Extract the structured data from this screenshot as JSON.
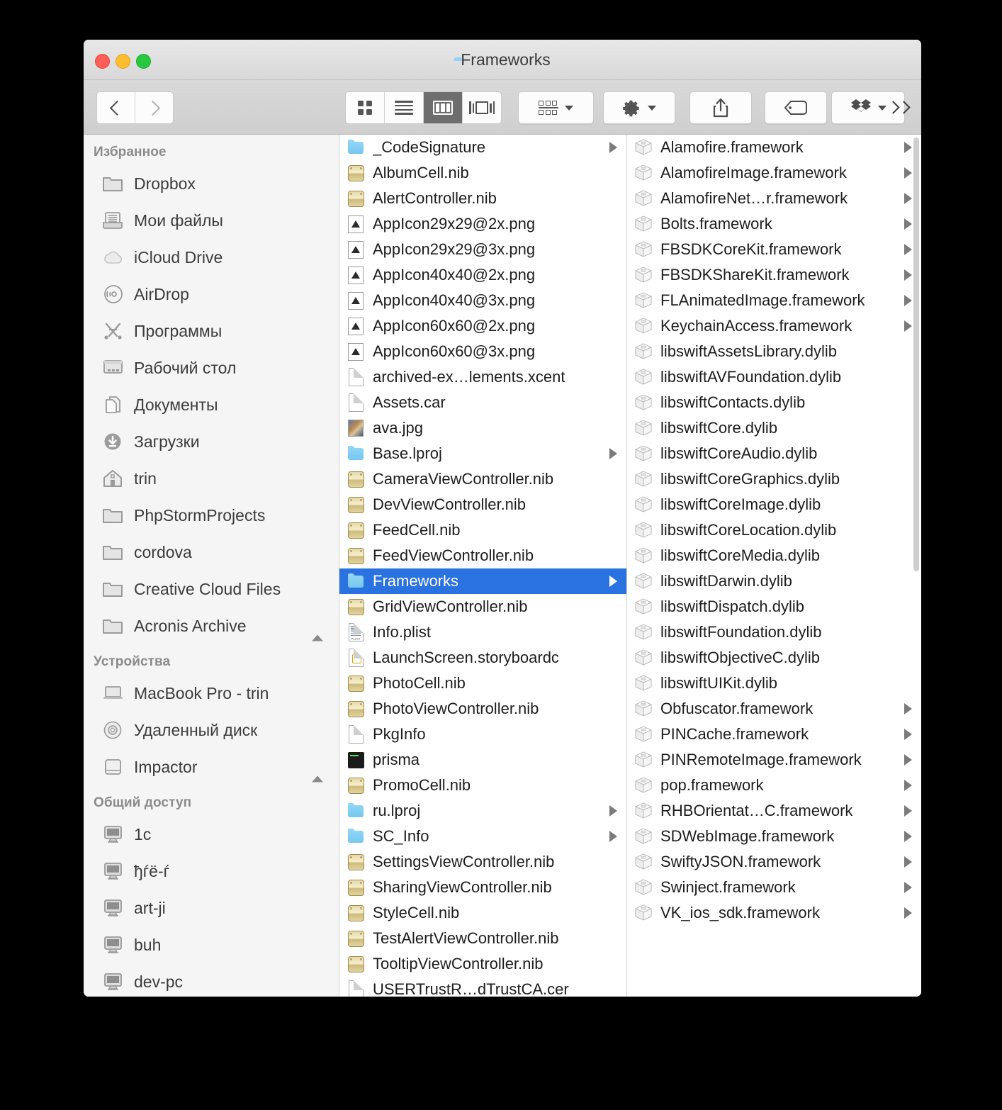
{
  "window": {
    "title": "Frameworks",
    "traffic_lights": [
      "close",
      "minimize",
      "zoom"
    ],
    "accent_selection": "#2a72e0"
  },
  "toolbar": {
    "back_label": "Back",
    "forward_label": "Forward",
    "views": [
      {
        "name": "icon-view",
        "label": "Icon View",
        "active": false
      },
      {
        "name": "list-view",
        "label": "List View",
        "active": false
      },
      {
        "name": "column-view",
        "label": "Column View",
        "active": true
      },
      {
        "name": "cover-flow-view",
        "label": "Cover Flow View",
        "active": false
      }
    ],
    "arrange_label": "Arrange",
    "action_label": "Action",
    "share_label": "Share",
    "tag_label": "Edit Tags",
    "dropbox_label": "Dropbox",
    "overflow_label": "More toolbar items"
  },
  "sidebar": {
    "sections": [
      {
        "header": "Избранное",
        "items": [
          {
            "label": "Dropbox",
            "icon": "folder-icon",
            "eject": false
          },
          {
            "label": "Мои файлы",
            "icon": "all-my-files-icon",
            "eject": false
          },
          {
            "label": "iCloud Drive",
            "icon": "icloud-icon",
            "eject": false
          },
          {
            "label": "AirDrop",
            "icon": "airdrop-icon",
            "eject": false
          },
          {
            "label": "Программы",
            "icon": "applications-icon",
            "eject": false
          },
          {
            "label": "Рабочий стол",
            "icon": "desktop-icon",
            "eject": false
          },
          {
            "label": "Документы",
            "icon": "documents-icon",
            "eject": false
          },
          {
            "label": "Загрузки",
            "icon": "downloads-icon",
            "eject": false
          },
          {
            "label": "trin",
            "icon": "home-icon",
            "eject": false
          },
          {
            "label": "PhpStormProjects",
            "icon": "folder-icon",
            "eject": false
          },
          {
            "label": "cordova",
            "icon": "folder-icon",
            "eject": false
          },
          {
            "label": "Creative Cloud Files",
            "icon": "folder-icon",
            "eject": false
          },
          {
            "label": "Acronis Archive",
            "icon": "folder-icon",
            "eject": true
          }
        ]
      },
      {
        "header": "Устройства",
        "items": [
          {
            "label": "MacBook Pro - trin",
            "icon": "laptop-icon",
            "eject": false
          },
          {
            "label": "Удаленный диск",
            "icon": "disc-icon",
            "eject": false
          },
          {
            "label": "Impactor",
            "icon": "harddisk-icon",
            "eject": true
          }
        ]
      },
      {
        "header": "Общий доступ",
        "items": [
          {
            "label": "1c",
            "icon": "display-icon",
            "eject": false
          },
          {
            "label": "ђѓё-ѓ",
            "icon": "display-icon",
            "eject": false
          },
          {
            "label": "art-ji",
            "icon": "display-icon",
            "eject": false
          },
          {
            "label": "buh",
            "icon": "display-icon",
            "eject": false
          },
          {
            "label": "dev-pc",
            "icon": "display-icon",
            "eject": false
          }
        ]
      }
    ]
  },
  "column_middle": {
    "rows": [
      {
        "name": "_CodeSignature",
        "icon": "folder-blue-icon",
        "disclosure": true,
        "selected": false
      },
      {
        "name": "AlbumCell.nib",
        "icon": "nib-icon",
        "disclosure": false,
        "selected": false
      },
      {
        "name": "AlertController.nib",
        "icon": "nib-icon",
        "disclosure": false,
        "selected": false
      },
      {
        "name": "AppIcon29x29@2x.png",
        "icon": "png-icon",
        "disclosure": false,
        "selected": false
      },
      {
        "name": "AppIcon29x29@3x.png",
        "icon": "png-icon",
        "disclosure": false,
        "selected": false
      },
      {
        "name": "AppIcon40x40@2x.png",
        "icon": "png-icon",
        "disclosure": false,
        "selected": false
      },
      {
        "name": "AppIcon40x40@3x.png",
        "icon": "png-icon",
        "disclosure": false,
        "selected": false
      },
      {
        "name": "AppIcon60x60@2x.png",
        "icon": "png-icon",
        "disclosure": false,
        "selected": false
      },
      {
        "name": "AppIcon60x60@3x.png",
        "icon": "png-icon",
        "disclosure": false,
        "selected": false
      },
      {
        "name": "archived-ex…lements.xcent",
        "icon": "document-icon",
        "disclosure": false,
        "selected": false
      },
      {
        "name": "Assets.car",
        "icon": "document-icon",
        "disclosure": false,
        "selected": false
      },
      {
        "name": "ava.jpg",
        "icon": "image-icon",
        "disclosure": false,
        "selected": false
      },
      {
        "name": "Base.lproj",
        "icon": "folder-blue-icon",
        "disclosure": true,
        "selected": false
      },
      {
        "name": "CameraViewController.nib",
        "icon": "nib-icon",
        "disclosure": false,
        "selected": false
      },
      {
        "name": "DevViewController.nib",
        "icon": "nib-icon",
        "disclosure": false,
        "selected": false
      },
      {
        "name": "FeedCell.nib",
        "icon": "nib-icon",
        "disclosure": false,
        "selected": false
      },
      {
        "name": "FeedViewController.nib",
        "icon": "nib-icon",
        "disclosure": false,
        "selected": false
      },
      {
        "name": "Frameworks",
        "icon": "folder-blue-icon",
        "disclosure": true,
        "selected": true
      },
      {
        "name": "GridViewController.nib",
        "icon": "nib-icon",
        "disclosure": false,
        "selected": false
      },
      {
        "name": "Info.plist",
        "icon": "plist-icon",
        "disclosure": false,
        "selected": false
      },
      {
        "name": "LaunchScreen.storyboardc",
        "icon": "storyboard-icon",
        "disclosure": false,
        "selected": false
      },
      {
        "name": "PhotoCell.nib",
        "icon": "nib-icon",
        "disclosure": false,
        "selected": false
      },
      {
        "name": "PhotoViewController.nib",
        "icon": "nib-icon",
        "disclosure": false,
        "selected": false
      },
      {
        "name": "PkgInfo",
        "icon": "document-icon",
        "disclosure": false,
        "selected": false
      },
      {
        "name": "prisma",
        "icon": "unix-executable-icon",
        "disclosure": false,
        "selected": false
      },
      {
        "name": "PromoCell.nib",
        "icon": "nib-icon",
        "disclosure": false,
        "selected": false
      },
      {
        "name": "ru.lproj",
        "icon": "folder-blue-icon",
        "disclosure": true,
        "selected": false
      },
      {
        "name": "SC_Info",
        "icon": "folder-blue-icon",
        "disclosure": true,
        "selected": false
      },
      {
        "name": "SettingsViewController.nib",
        "icon": "nib-icon",
        "disclosure": false,
        "selected": false
      },
      {
        "name": "SharingViewController.nib",
        "icon": "nib-icon",
        "disclosure": false,
        "selected": false
      },
      {
        "name": "StyleCell.nib",
        "icon": "nib-icon",
        "disclosure": false,
        "selected": false
      },
      {
        "name": "TestAlertViewController.nib",
        "icon": "nib-icon",
        "disclosure": false,
        "selected": false
      },
      {
        "name": "TooltipViewController.nib",
        "icon": "nib-icon",
        "disclosure": false,
        "selected": false
      },
      {
        "name": "USERTrustR…dTrustCA.cer",
        "icon": "document-icon",
        "disclosure": false,
        "selected": false
      }
    ]
  },
  "column_right": {
    "rows": [
      {
        "name": "Alamofire.framework",
        "icon": "framework-icon",
        "disclosure": true
      },
      {
        "name": "AlamofireImage.framework",
        "icon": "framework-icon",
        "disclosure": true
      },
      {
        "name": "AlamofireNet…r.framework",
        "icon": "framework-icon",
        "disclosure": true
      },
      {
        "name": "Bolts.framework",
        "icon": "framework-icon",
        "disclosure": true
      },
      {
        "name": "FBSDKCoreKit.framework",
        "icon": "framework-icon",
        "disclosure": true
      },
      {
        "name": "FBSDKShareKit.framework",
        "icon": "framework-icon",
        "disclosure": true
      },
      {
        "name": "FLAnimatedImage.framework",
        "icon": "framework-icon",
        "disclosure": true
      },
      {
        "name": "KeychainAccess.framework",
        "icon": "framework-icon",
        "disclosure": true
      },
      {
        "name": "libswiftAssetsLibrary.dylib",
        "icon": "framework-icon",
        "disclosure": false
      },
      {
        "name": "libswiftAVFoundation.dylib",
        "icon": "framework-icon",
        "disclosure": false
      },
      {
        "name": "libswiftContacts.dylib",
        "icon": "framework-icon",
        "disclosure": false
      },
      {
        "name": "libswiftCore.dylib",
        "icon": "framework-icon",
        "disclosure": false
      },
      {
        "name": "libswiftCoreAudio.dylib",
        "icon": "framework-icon",
        "disclosure": false
      },
      {
        "name": "libswiftCoreGraphics.dylib",
        "icon": "framework-icon",
        "disclosure": false
      },
      {
        "name": "libswiftCoreImage.dylib",
        "icon": "framework-icon",
        "disclosure": false
      },
      {
        "name": "libswiftCoreLocation.dylib",
        "icon": "framework-icon",
        "disclosure": false
      },
      {
        "name": "libswiftCoreMedia.dylib",
        "icon": "framework-icon",
        "disclosure": false
      },
      {
        "name": "libswiftDarwin.dylib",
        "icon": "framework-icon",
        "disclosure": false
      },
      {
        "name": "libswiftDispatch.dylib",
        "icon": "framework-icon",
        "disclosure": false
      },
      {
        "name": "libswiftFoundation.dylib",
        "icon": "framework-icon",
        "disclosure": false
      },
      {
        "name": "libswiftObjectiveC.dylib",
        "icon": "framework-icon",
        "disclosure": false
      },
      {
        "name": "libswiftUIKit.dylib",
        "icon": "framework-icon",
        "disclosure": false
      },
      {
        "name": "Obfuscator.framework",
        "icon": "framework-icon",
        "disclosure": true
      },
      {
        "name": "PINCache.framework",
        "icon": "framework-icon",
        "disclosure": true
      },
      {
        "name": "PINRemoteImage.framework",
        "icon": "framework-icon",
        "disclosure": true
      },
      {
        "name": "pop.framework",
        "icon": "framework-icon",
        "disclosure": true
      },
      {
        "name": "RHBOrientat…C.framework",
        "icon": "framework-icon",
        "disclosure": true
      },
      {
        "name": "SDWebImage.framework",
        "icon": "framework-icon",
        "disclosure": true
      },
      {
        "name": "SwiftyJSON.framework",
        "icon": "framework-icon",
        "disclosure": true
      },
      {
        "name": "Swinject.framework",
        "icon": "framework-icon",
        "disclosure": true
      },
      {
        "name": "VK_ios_sdk.framework",
        "icon": "framework-icon",
        "disclosure": true
      }
    ]
  }
}
